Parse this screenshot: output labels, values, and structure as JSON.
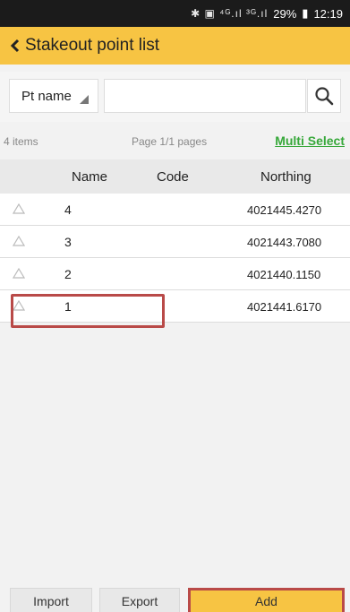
{
  "status_bar": {
    "icons": "✱ ▣ ⁴ᴳ.ıl ³ᴳ.ıl",
    "battery": "29%",
    "time": "12:19"
  },
  "header": {
    "title": "Stakeout point list",
    "back_icon": "chevron-left-icon",
    "accent_color": "#f7c443"
  },
  "search": {
    "field_select": "Pt name",
    "input_value": "",
    "input_placeholder": ""
  },
  "info": {
    "item_count": "4 items",
    "page_info": "Page 1/1 pages",
    "multi_select_label": "Multi Select",
    "multi_select_color": "#37a83a"
  },
  "table": {
    "columns": [
      "Name",
      "Code",
      "Northing"
    ],
    "rows": [
      {
        "name": "4",
        "code": "",
        "northing": "4021445.4270"
      },
      {
        "name": "3",
        "code": "",
        "northing": "4021443.7080"
      },
      {
        "name": "2",
        "code": "",
        "northing": "4021440.1150"
      },
      {
        "name": "1",
        "code": "",
        "northing": "4021441.6170"
      }
    ]
  },
  "bottom": {
    "import_label": "Import",
    "export_label": "Export",
    "add_label": "Add"
  },
  "highlight_color": "#b94a48"
}
